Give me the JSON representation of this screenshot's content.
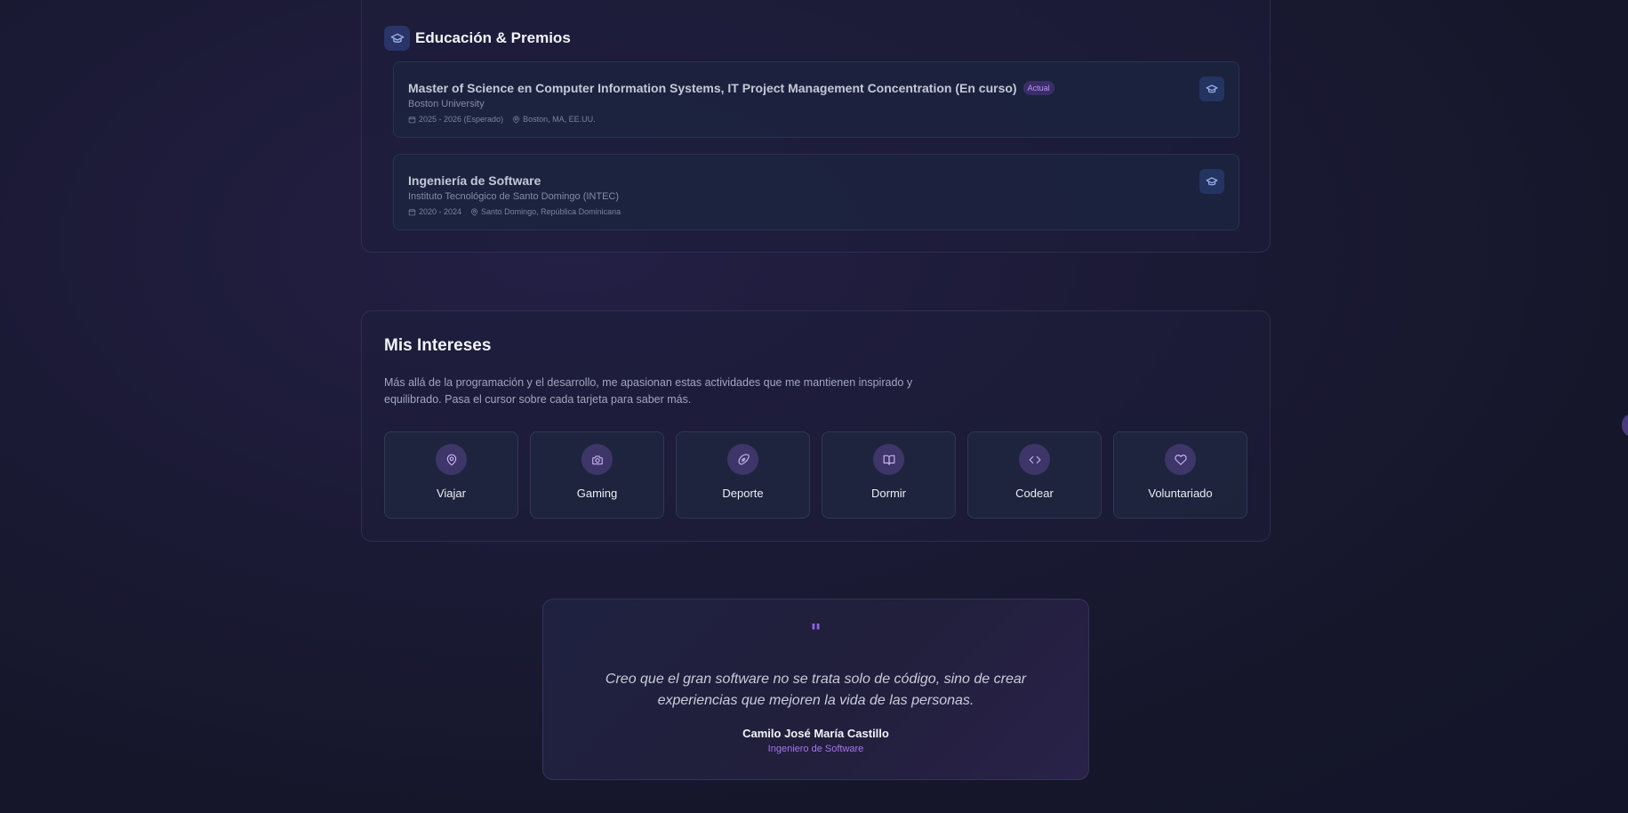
{
  "education": {
    "title": "Educación & Premios",
    "items": [
      {
        "degree": "Master of Science en Computer Information Systems, IT Project Management Concentration (En curso)",
        "badge": "Actual",
        "school": "Boston University",
        "dates": "2025 - 2026 (Esperado)",
        "location": "Boston, MA, EE.UU."
      },
      {
        "degree": "Ingeniería de Software",
        "school": "Instituto Tecnológico de Santo Domingo (INTEC)",
        "dates": "2020 - 2024",
        "location": "Santo Domingo, República Dominicana"
      }
    ]
  },
  "interests": {
    "title": "Mis Intereses",
    "description": "Más allá de la programación y el desarrollo, me apasionan estas actividades que me mantienen inspirado y equilibrado. Pasa el cursor sobre cada tarjeta para saber más.",
    "items": [
      {
        "label": "Viajar",
        "icon": "map-pin-icon"
      },
      {
        "label": "Gaming",
        "icon": "camera-icon"
      },
      {
        "label": "Deporte",
        "icon": "rugby-ball-icon"
      },
      {
        "label": "Dormir",
        "icon": "book-icon"
      },
      {
        "label": "Codear",
        "icon": "code-icon"
      },
      {
        "label": "Voluntariado",
        "icon": "heart-icon"
      }
    ]
  },
  "quote": {
    "mark": "\"",
    "text": "Creo que el gran software no se trata solo de código, sino de crear experiencias que mejoren la vida de las personas.",
    "author": "Camilo José María Castillo",
    "role": "Ingeniero de Software"
  },
  "colors": {
    "accent": "#8f62e0",
    "badge_text": "#b896f2",
    "icon_blue": "#9fb3f0",
    "icon_purple": "#c9b3f5"
  }
}
